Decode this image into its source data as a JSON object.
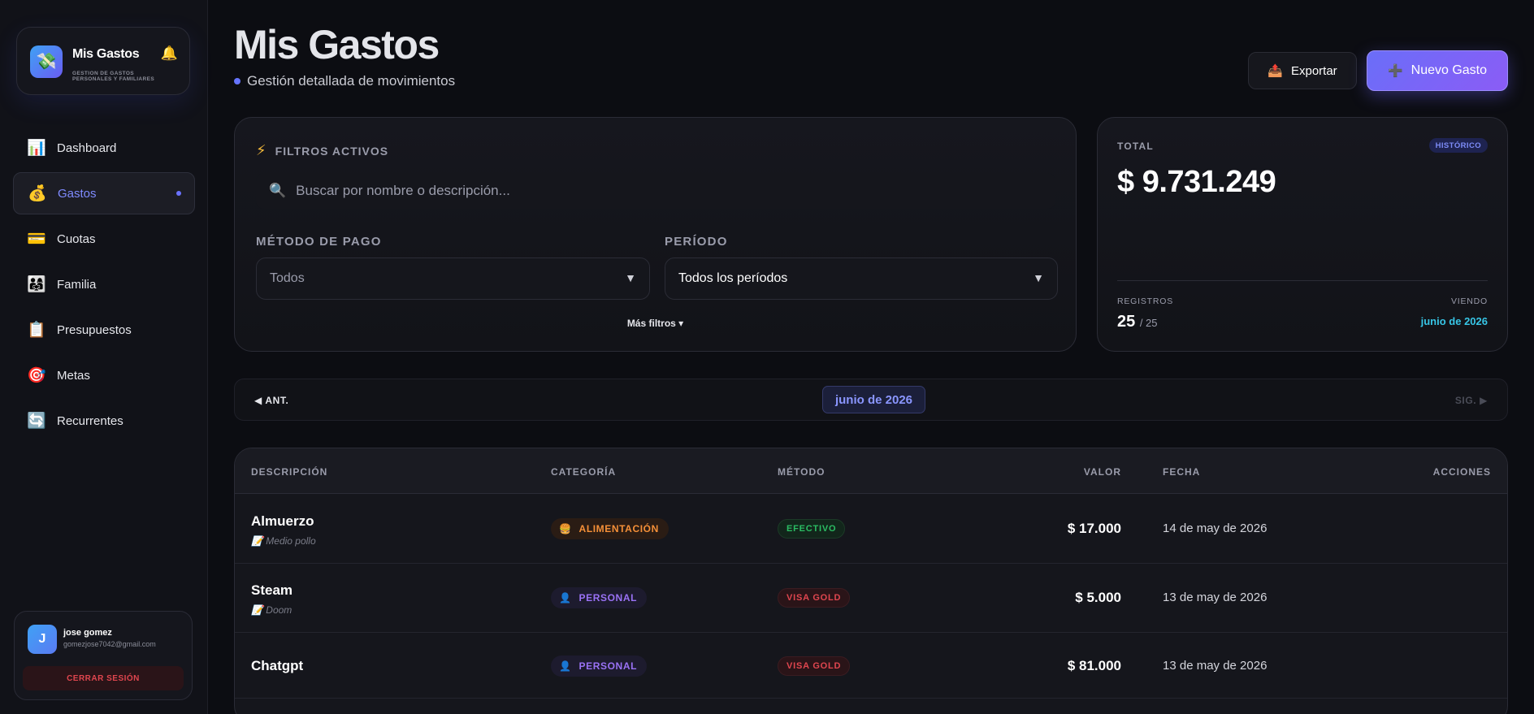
{
  "brand": {
    "logo_icon": "💸",
    "title": "Mis Gastos",
    "subtitle": "GESTION DE GASTOS PERSONALES Y FAMILIARES",
    "bell_icon": "🔔"
  },
  "sidebar": {
    "items": [
      {
        "icon": "📊",
        "label": "Dashboard"
      },
      {
        "icon": "💰",
        "label": "Gastos"
      },
      {
        "icon": "💳",
        "label": "Cuotas"
      },
      {
        "icon": "👨‍👩‍👧",
        "label": "Familia"
      },
      {
        "icon": "📋",
        "label": "Presupuestos"
      },
      {
        "icon": "🎯",
        "label": "Metas"
      },
      {
        "icon": "🔄",
        "label": "Recurrentes"
      }
    ],
    "active_index": 1
  },
  "user": {
    "initial": "J",
    "name": "jose gomez",
    "email": "gomezjose7042@gmail.com",
    "logout_label": "CERRAR SESIÓN"
  },
  "header": {
    "title": "Mis Gastos",
    "subtitle": "Gestión detallada de movimientos",
    "export_icon": "📤",
    "export_label": "Exportar",
    "new_icon": "➕",
    "new_label": "Nuevo Gasto"
  },
  "filters": {
    "title_icon": "⚡",
    "title": "FILTROS ACTIVOS",
    "search_icon": "🔍",
    "search_placeholder": "Buscar por nombre o descripción...",
    "payment_label": "MÉTODO DE PAGO",
    "payment_value": "Todos",
    "period_label": "PERÍODO",
    "period_value": "Todos los períodos",
    "arrow": "▼",
    "more_label": "Más filtros ▾"
  },
  "summary": {
    "total_label": "TOTAL",
    "badge": "HISTÓRICO",
    "total_value": "$ 9.731.249",
    "records_label": "REGISTROS",
    "records_shown": "25",
    "records_total": "/ 25",
    "viewing_label": "VIENDO",
    "viewing_value": "junio de 2026"
  },
  "month_nav": {
    "prev_label": "◀ ANT.",
    "current": "junio de 2026",
    "next_label": "SIG. ▶"
  },
  "table": {
    "headers": [
      "DESCRIPCIÓN",
      "CATEGORÍA",
      "MÉTODO",
      "VALOR",
      "FECHA",
      "ACCIONES"
    ],
    "rows": [
      {
        "name": "Almuerzo",
        "note": "📝 Medio pollo",
        "category_icon": "🍔",
        "category": "ALIMENTACIÓN",
        "method": "EFECTIVO",
        "value": "$ 17.000",
        "date": "14 de may de 2026"
      },
      {
        "name": "Steam",
        "note": "📝 Doom",
        "category_icon": "👤",
        "category": "PERSONAL",
        "method": "VISA GOLD",
        "value": "$ 5.000",
        "date": "13 de may de 2026"
      },
      {
        "name": "Chatgpt",
        "note": "",
        "category_icon": "👤",
        "category": "PERSONAL",
        "method": "VISA GOLD",
        "value": "$ 81.000",
        "date": "13 de may de 2026"
      }
    ]
  },
  "colors": {
    "accent": "#6a72ff",
    "cash": "#2bbd63",
    "visa": "#e0464f",
    "food": "#f59038",
    "personal": "#9a72f5",
    "viewing": "#37c6e6"
  }
}
